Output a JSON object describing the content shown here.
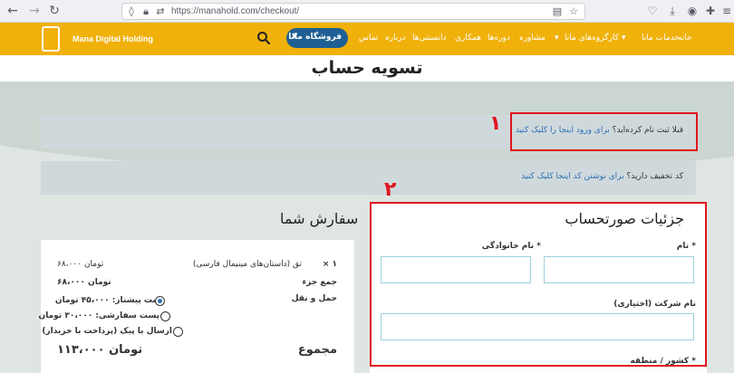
{
  "browser": {
    "url": "https://manahold.com/checkout/",
    "back_icon": "arrow-left-icon",
    "forward_icon": "arrow-right-icon",
    "reload_icon": "reload-icon"
  },
  "header": {
    "menu": [
      "خانه",
      "خدمات مانا",
      "کارگروه‌های مانا",
      "مشاوره",
      "دوره‌ها",
      "همکاری",
      "دانستنی‌ها",
      "درباره",
      "تماس"
    ],
    "shop_button": "فروشگاه مانا",
    "logo_text": "Mana Digital Holding",
    "colors": {
      "header_bg": "#f0b10b",
      "shop_button": "#1f5f93"
    }
  },
  "page": {
    "title": "تسویه حساب"
  },
  "notices": {
    "login_prefix": "قبلا ثبت نام کرده‌اید؟",
    "login_link": "برای ورود اینجا را کلیک کنید",
    "coupon_prefix": "کد تخفیف دارید؟",
    "coupon_link": "برای نوشتن کد اینجا کلیک کنید"
  },
  "annotations": {
    "marker_1": "۱",
    "marker_2": "۲",
    "color": "#e0141e"
  },
  "billing": {
    "title": "جزئیات صورتحساب",
    "first_name_label": "نام *",
    "last_name_label": "نام خانوادگی *",
    "company_label": "نام شرکت (اختیاری)",
    "country_label": "کشور / منطقه *"
  },
  "order": {
    "title": "سفارش شما",
    "product_name": "تق (داستان‌های مینیمال فارسی)",
    "product_qty": "× ۱",
    "product_price": "۶۸،۰۰۰ تومان",
    "subtotal_label": "جمع جزء",
    "subtotal_value": "۶۸،۰۰۰ تومان",
    "shipping_label": "حمل و نقل",
    "shipping_options": [
      {
        "label": "پست پیشتاز: ۴۵،۰۰۰ تومان",
        "selected": true
      },
      {
        "label": "پست سفارشی: ۳۰،۰۰۰ تومان",
        "selected": false
      },
      {
        "label": "ارسال با پیک (پرداخت با خریدار)",
        "selected": false
      }
    ],
    "total_label": "مجموع",
    "total_value": "۱۱۳،۰۰۰ تومان"
  }
}
